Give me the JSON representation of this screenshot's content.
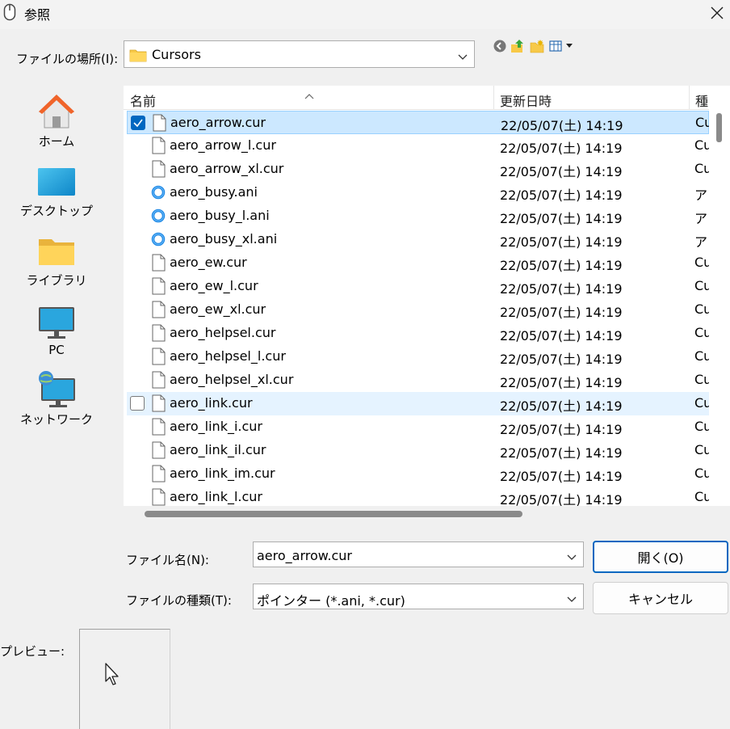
{
  "window": {
    "title": "参照",
    "close_icon": "close-icon",
    "app_icon": "mouse-icon"
  },
  "location": {
    "label": "ファイルの場所(I):",
    "value": "Cursors"
  },
  "toolbar": {
    "icons": [
      "back-icon",
      "up-folder-icon",
      "new-folder-icon",
      "view-menu-icon"
    ]
  },
  "places": [
    {
      "label": "ホーム",
      "icon": "home-icon"
    },
    {
      "label": "デスクトップ",
      "icon": "desktop-icon"
    },
    {
      "label": "ライブラリ",
      "icon": "library-icon"
    },
    {
      "label": "PC",
      "icon": "pc-icon"
    },
    {
      "label": "ネットワーク",
      "icon": "network-icon"
    }
  ],
  "list": {
    "columns": {
      "name": "名前",
      "modified": "更新日時",
      "type": "種"
    },
    "rows": [
      {
        "name": "aero_arrow.cur",
        "date": "22/05/07(土) 14:19",
        "type": "Cu",
        "kind": "cur",
        "state": "selected"
      },
      {
        "name": "aero_arrow_l.cur",
        "date": "22/05/07(土) 14:19",
        "type": "Cu",
        "kind": "cur",
        "state": ""
      },
      {
        "name": "aero_arrow_xl.cur",
        "date": "22/05/07(土) 14:19",
        "type": "Cu",
        "kind": "cur",
        "state": ""
      },
      {
        "name": "aero_busy.ani",
        "date": "22/05/07(土) 14:19",
        "type": "ア",
        "kind": "ani",
        "state": ""
      },
      {
        "name": "aero_busy_l.ani",
        "date": "22/05/07(土) 14:19",
        "type": "ア",
        "kind": "ani",
        "state": ""
      },
      {
        "name": "aero_busy_xl.ani",
        "date": "22/05/07(土) 14:19",
        "type": "ア",
        "kind": "ani",
        "state": ""
      },
      {
        "name": "aero_ew.cur",
        "date": "22/05/07(土) 14:19",
        "type": "Cu",
        "kind": "cur",
        "state": ""
      },
      {
        "name": "aero_ew_l.cur",
        "date": "22/05/07(土) 14:19",
        "type": "Cu",
        "kind": "cur",
        "state": ""
      },
      {
        "name": "aero_ew_xl.cur",
        "date": "22/05/07(土) 14:19",
        "type": "Cu",
        "kind": "cur",
        "state": ""
      },
      {
        "name": "aero_helpsel.cur",
        "date": "22/05/07(土) 14:19",
        "type": "Cu",
        "kind": "cur",
        "state": ""
      },
      {
        "name": "aero_helpsel_l.cur",
        "date": "22/05/07(土) 14:19",
        "type": "Cu",
        "kind": "cur",
        "state": ""
      },
      {
        "name": "aero_helpsel_xl.cur",
        "date": "22/05/07(土) 14:19",
        "type": "Cu",
        "kind": "cur",
        "state": ""
      },
      {
        "name": "aero_link.cur",
        "date": "22/05/07(土) 14:19",
        "type": "Cu",
        "kind": "cur",
        "state": "hover"
      },
      {
        "name": "aero_link_i.cur",
        "date": "22/05/07(土) 14:19",
        "type": "Cu",
        "kind": "cur",
        "state": ""
      },
      {
        "name": "aero_link_il.cur",
        "date": "22/05/07(土) 14:19",
        "type": "Cu",
        "kind": "cur",
        "state": ""
      },
      {
        "name": "aero_link_im.cur",
        "date": "22/05/07(土) 14:19",
        "type": "Cu",
        "kind": "cur",
        "state": ""
      },
      {
        "name": "aero_link_l.cur",
        "date": "22/05/07(土) 14:19",
        "type": "Cu",
        "kind": "cur",
        "state": ""
      }
    ]
  },
  "filename": {
    "label": "ファイル名(N):",
    "value": "aero_arrow.cur"
  },
  "filetype": {
    "label": "ファイルの種類(T):",
    "value": "ポインター (*.ani, *.cur)"
  },
  "buttons": {
    "open": "開く(O)",
    "cancel": "キャンセル"
  },
  "preview": {
    "label": "プレビュー:",
    "icon": "arrow-cursor-icon"
  },
  "colors": {
    "accent": "#0067c0",
    "selected_row": "#cce8ff",
    "hover_row": "#e5f3ff"
  }
}
